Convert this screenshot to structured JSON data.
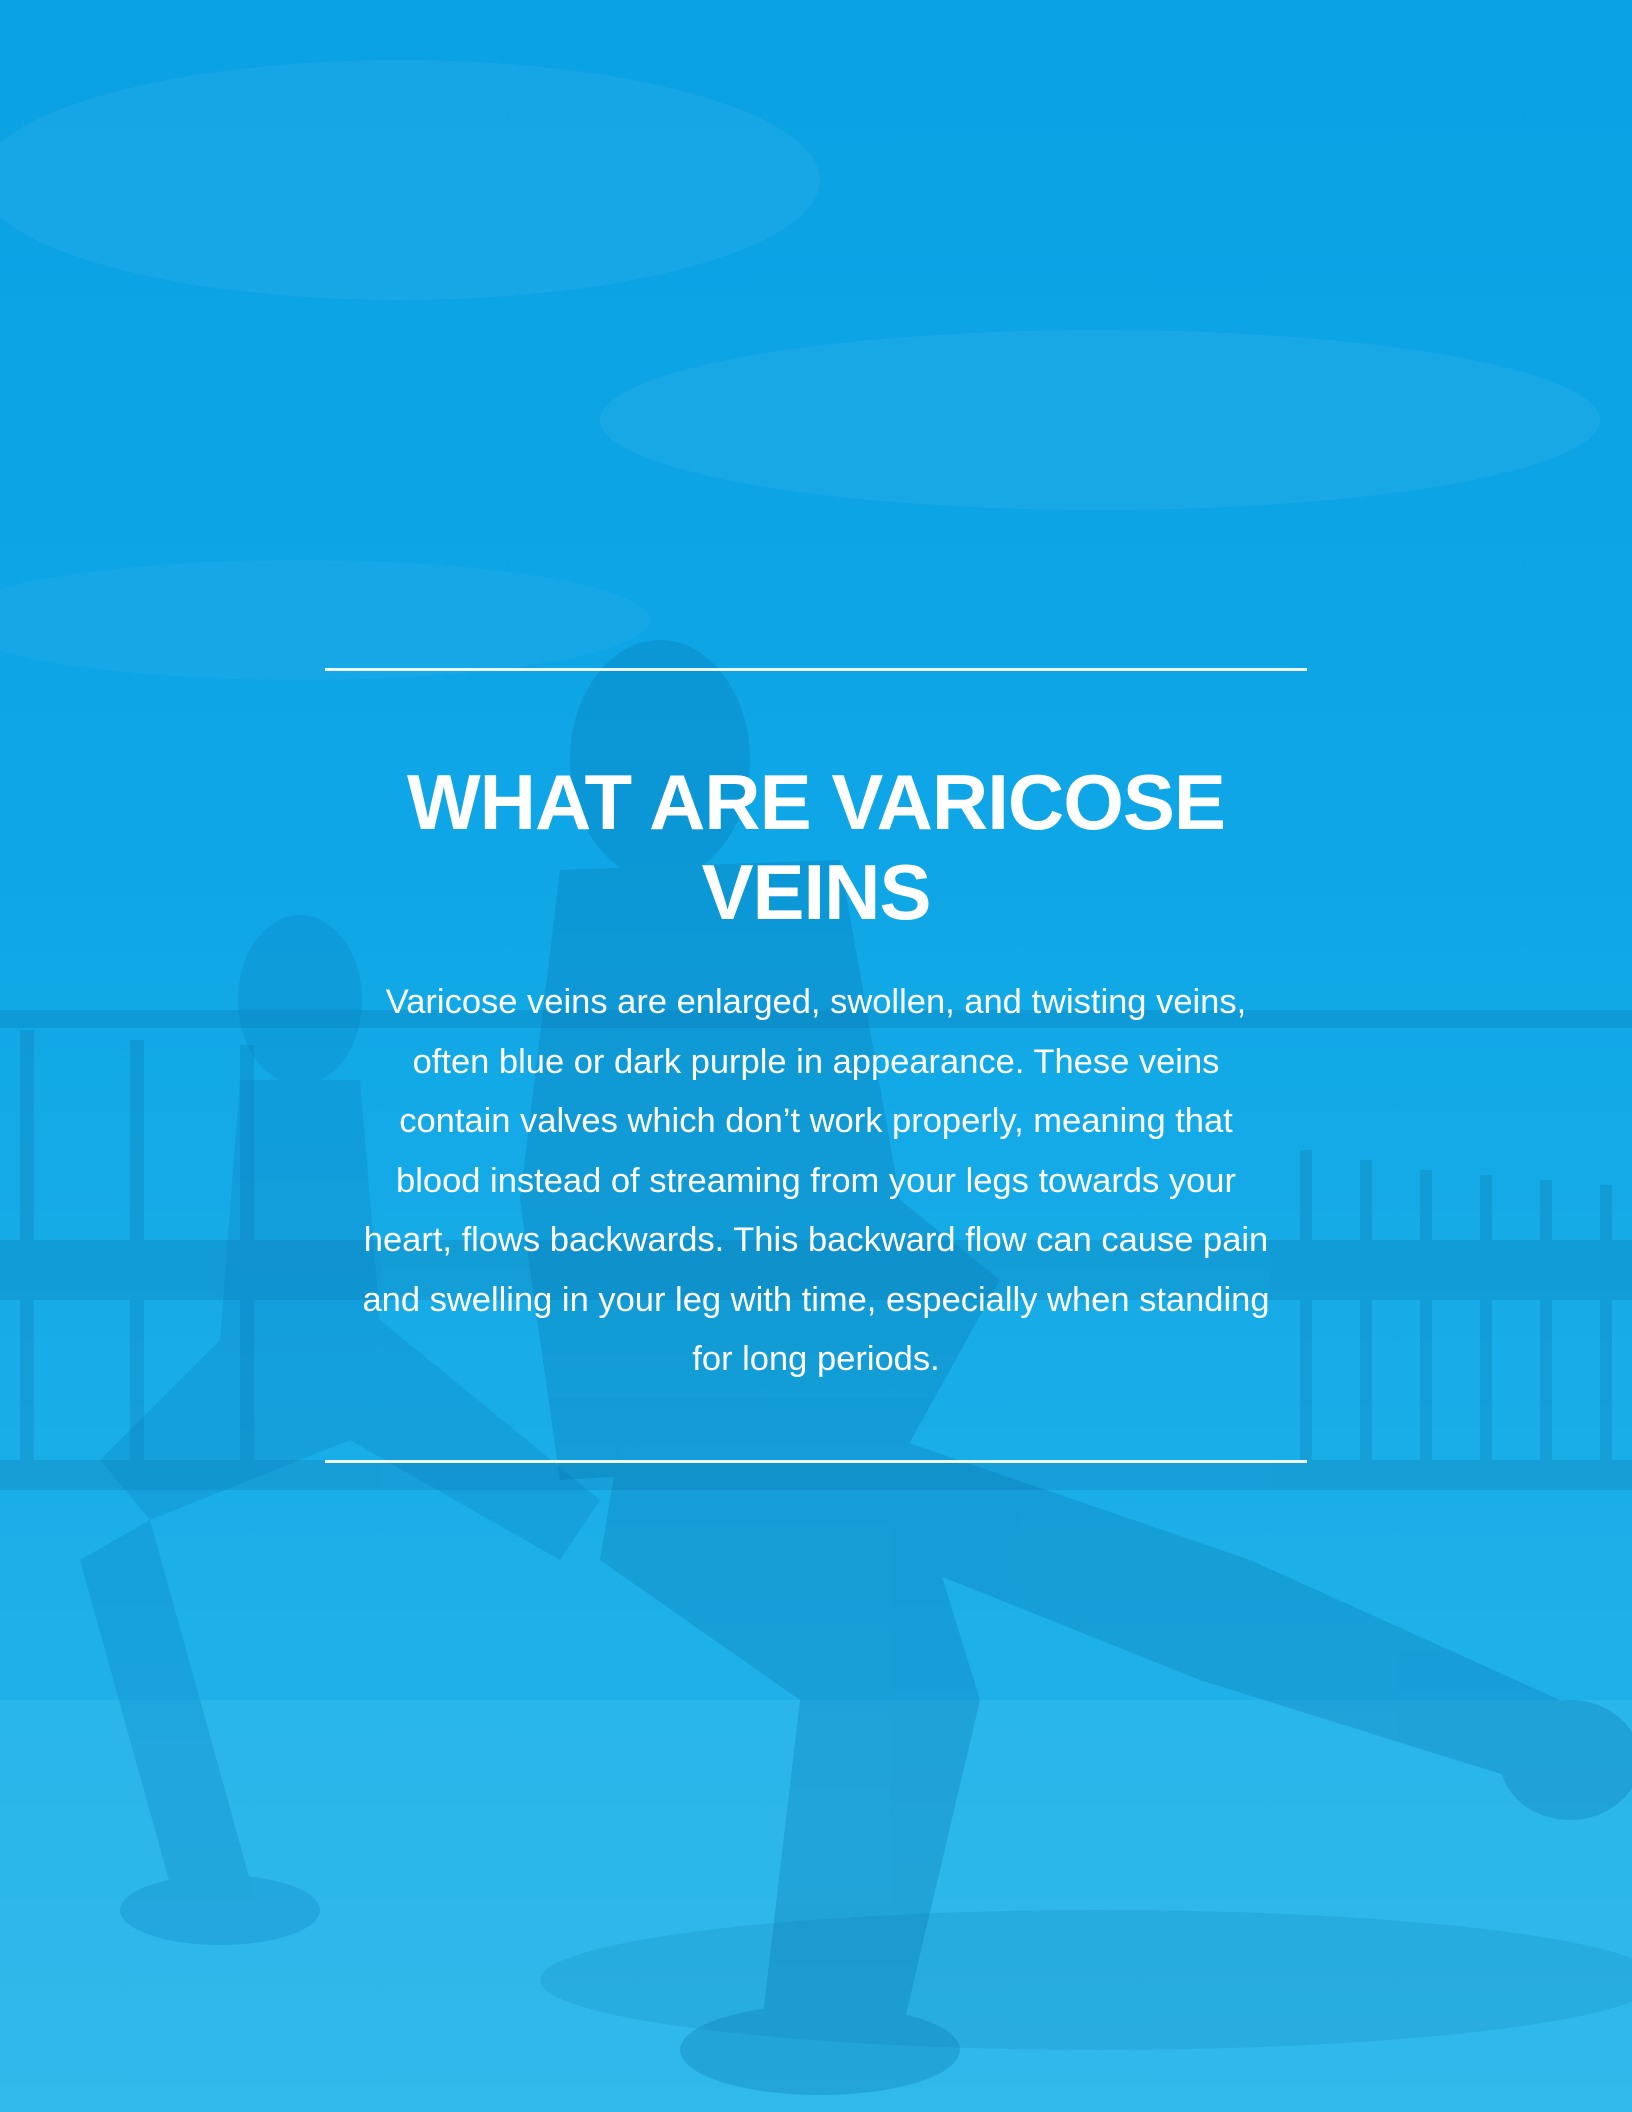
{
  "accent_color": "#0ea6e6",
  "background_image": "people-stretching-outdoors-photo",
  "section": {
    "title": "WHAT ARE VARICOSE VEINS",
    "body": "Varicose veins are enlarged, swollen, and twisting veins, often blue or dark purple in appearance. These veins contain valves which don’t work properly, meaning that blood instead of streaming from your legs towards your heart, flows backwards. This backward flow can cause pain and swelling in your leg with time, especially when standing for long periods."
  }
}
